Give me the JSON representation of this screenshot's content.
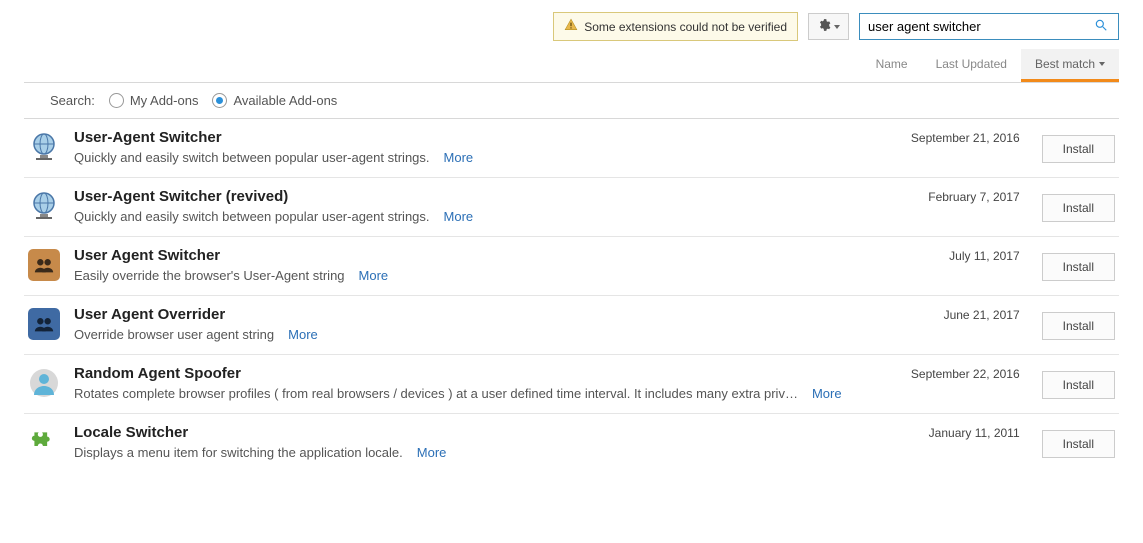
{
  "warning": "Some extensions could not be verified",
  "search": {
    "value": "user agent switcher"
  },
  "sort": {
    "name": "Name",
    "lastUpdated": "Last Updated",
    "bestMatch": "Best match"
  },
  "filter": {
    "label": "Search:",
    "myAddons": "My Add-ons",
    "availableAddons": "Available Add-ons"
  },
  "moreLabel": "More",
  "installLabel": "Install",
  "addons": [
    {
      "title": "User-Agent Switcher",
      "desc": "Quickly and easily switch between popular user-agent strings.",
      "date": "September 21, 2016",
      "icon": "globe"
    },
    {
      "title": "User-Agent Switcher (revived)",
      "desc": "Quickly and easily switch between popular user-agent strings.",
      "date": "February 7, 2017",
      "icon": "globe"
    },
    {
      "title": "User Agent Switcher",
      "desc": "Easily override the browser's User-Agent string",
      "date": "July 11, 2017",
      "icon": "people-brown"
    },
    {
      "title": "User Agent Overrider",
      "desc": "Override browser user agent string",
      "date": "June 21, 2017",
      "icon": "people-blue"
    },
    {
      "title": "Random Agent Spoofer",
      "desc": "Rotates complete browser profiles ( from real browsers / devices ) at a user defined time interval. It includes many extra priv…",
      "date": "September 22, 2016",
      "icon": "avatar"
    },
    {
      "title": "Locale Switcher",
      "desc": "Displays a menu item for switching the application locale.",
      "date": "January 11, 2011",
      "icon": "puzzle"
    }
  ]
}
